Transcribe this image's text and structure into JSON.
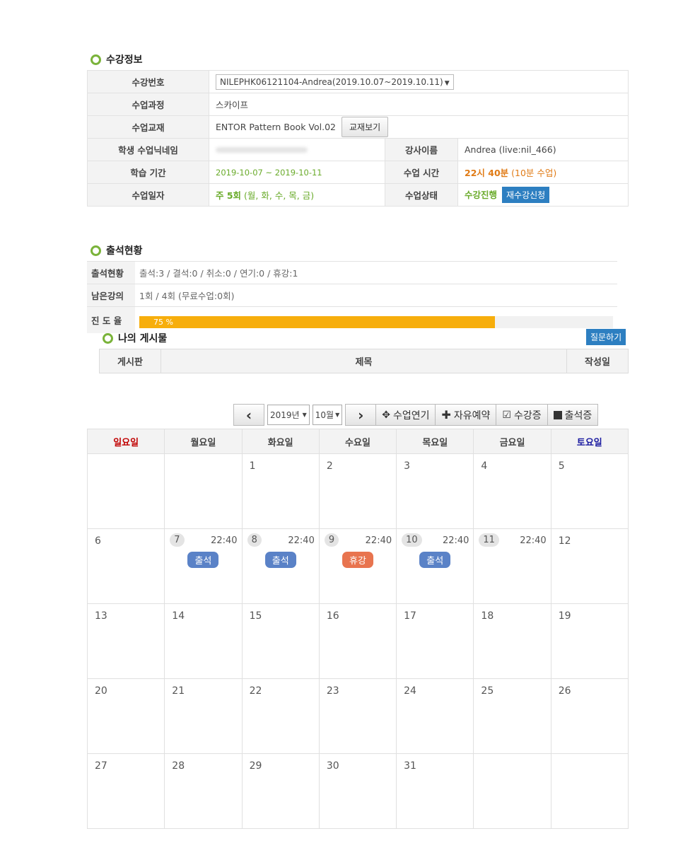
{
  "course_info": {
    "title": "수강정보",
    "rows": {
      "enroll_no_label": "수강번호",
      "enroll_no_value": "NILEPHK06121104-Andrea(2019.10.07~2019.10.11)",
      "course_label": "수업과정",
      "course_value": "스카이프",
      "textbook_label": "수업교재",
      "textbook_value": "ENTOR Pattern Book Vol.02",
      "textbook_button": "교재보기",
      "nickname_label": "학생 수업닉네임",
      "nickname_value": "",
      "teacher_label": "강사이름",
      "teacher_value": "Andrea (live:nil_466)",
      "period_label": "학습 기간",
      "period_value": "2019-10-07 ~ 2019-10-11",
      "time_label": "수업 시간",
      "time_value": "22시 40분",
      "time_extra": "(10분 수업)",
      "days_label": "수업일자",
      "days_value": "주 5회",
      "days_extra": "(월, 화, 수, 목, 금)",
      "status_label": "수업상태",
      "status_value": "수강진행",
      "reenroll_button": "재수강신청"
    }
  },
  "attendance": {
    "title": "출석현황",
    "status_label": "출석현황",
    "status_value": "출석:3 / 결석:0 / 취소:0 / 연기:0 / 휴강:1",
    "remain_label": "남은강의",
    "remain_value": "1회 / 4회 (무료수업:0회)",
    "progress_label": "진 도 율",
    "progress_text": "75 %",
    "progress_percent": 75
  },
  "my_posts": {
    "title": "나의 게시물",
    "ask_button": "질문하기",
    "col_board": "게시판",
    "col_subject": "제목",
    "col_date": "작성일"
  },
  "toolbar": {
    "prev": "‹",
    "year": "2019년",
    "month": "10월",
    "next": "›",
    "postpone": "수업연기",
    "free_reserve": "자유예약",
    "certificate": "수강증",
    "attendance_cert": "출석증"
  },
  "calendar": {
    "weekdays": [
      "일요일",
      "월요일",
      "화요일",
      "수요일",
      "목요일",
      "금요일",
      "토요일"
    ],
    "colors": {
      "sunday": "#c00000",
      "saturday": "#1a1aa0",
      "attend": "#5a82c7",
      "rest": "#e8744f"
    },
    "weeks": [
      [
        {
          "d": ""
        },
        {
          "d": ""
        },
        {
          "d": "1"
        },
        {
          "d": "2"
        },
        {
          "d": "3"
        },
        {
          "d": "4"
        },
        {
          "d": "5"
        }
      ],
      [
        {
          "d": "6"
        },
        {
          "d": "7",
          "time": "22:40",
          "badge": "출석"
        },
        {
          "d": "8",
          "time": "22:40",
          "badge": "출석"
        },
        {
          "d": "9",
          "time": "22:40",
          "badge": "휴강"
        },
        {
          "d": "10",
          "time": "22:40",
          "badge": "출석"
        },
        {
          "d": "11",
          "time": "22:40"
        },
        {
          "d": "12"
        }
      ],
      [
        {
          "d": "13"
        },
        {
          "d": "14"
        },
        {
          "d": "15"
        },
        {
          "d": "16"
        },
        {
          "d": "17"
        },
        {
          "d": "18"
        },
        {
          "d": "19"
        }
      ],
      [
        {
          "d": "20"
        },
        {
          "d": "21"
        },
        {
          "d": "22"
        },
        {
          "d": "23"
        },
        {
          "d": "24"
        },
        {
          "d": "25"
        },
        {
          "d": "26"
        }
      ],
      [
        {
          "d": "27"
        },
        {
          "d": "28"
        },
        {
          "d": "29"
        },
        {
          "d": "30"
        },
        {
          "d": "31"
        },
        {
          "d": ""
        },
        {
          "d": ""
        }
      ]
    ]
  }
}
